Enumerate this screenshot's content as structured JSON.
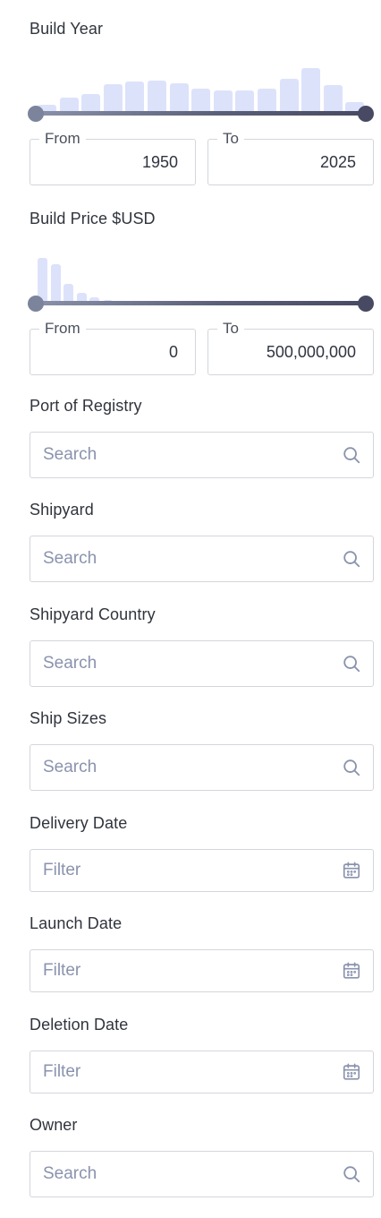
{
  "build_year": {
    "label": "Build Year",
    "histogram": [
      0.17,
      0.33,
      0.41,
      0.63,
      0.7,
      0.71,
      0.65,
      0.53,
      0.49,
      0.49,
      0.53,
      0.76,
      1.0,
      0.62,
      0.24
    ],
    "from_legend": "From",
    "to_legend": "To",
    "from_value": "1950",
    "to_value": "2025"
  },
  "build_price": {
    "label": "Build Price $USD",
    "histogram": [
      1.0,
      0.86,
      0.42,
      0.22,
      0.11,
      0.05,
      0.04,
      0.03,
      0.02
    ],
    "from_legend": "From",
    "to_legend": "To",
    "from_value": "0",
    "to_value": "500,000,000"
  },
  "filters": [
    {
      "label": "Port of Registry",
      "placeholder": "Search",
      "icon": "search-icon"
    },
    {
      "label": "Shipyard",
      "placeholder": "Search",
      "icon": "search-icon"
    },
    {
      "label": "Shipyard Country",
      "placeholder": "Search",
      "icon": "search-icon"
    },
    {
      "label": "Ship Sizes",
      "placeholder": "Search",
      "icon": "search-icon"
    },
    {
      "label": "Delivery Date",
      "placeholder": "Filter",
      "icon": "calendar-icon"
    },
    {
      "label": "Launch Date",
      "placeholder": "Filter",
      "icon": "calendar-icon"
    },
    {
      "label": "Deletion Date",
      "placeholder": "Filter",
      "icon": "calendar-icon"
    },
    {
      "label": "Owner",
      "placeholder": "Search",
      "icon": "search-icon"
    }
  ],
  "colors": {
    "histogram_bar": "#dde2fb",
    "slider_track": "#474a62",
    "border": "#d3d6dd",
    "placeholder": "#8a93ad"
  }
}
